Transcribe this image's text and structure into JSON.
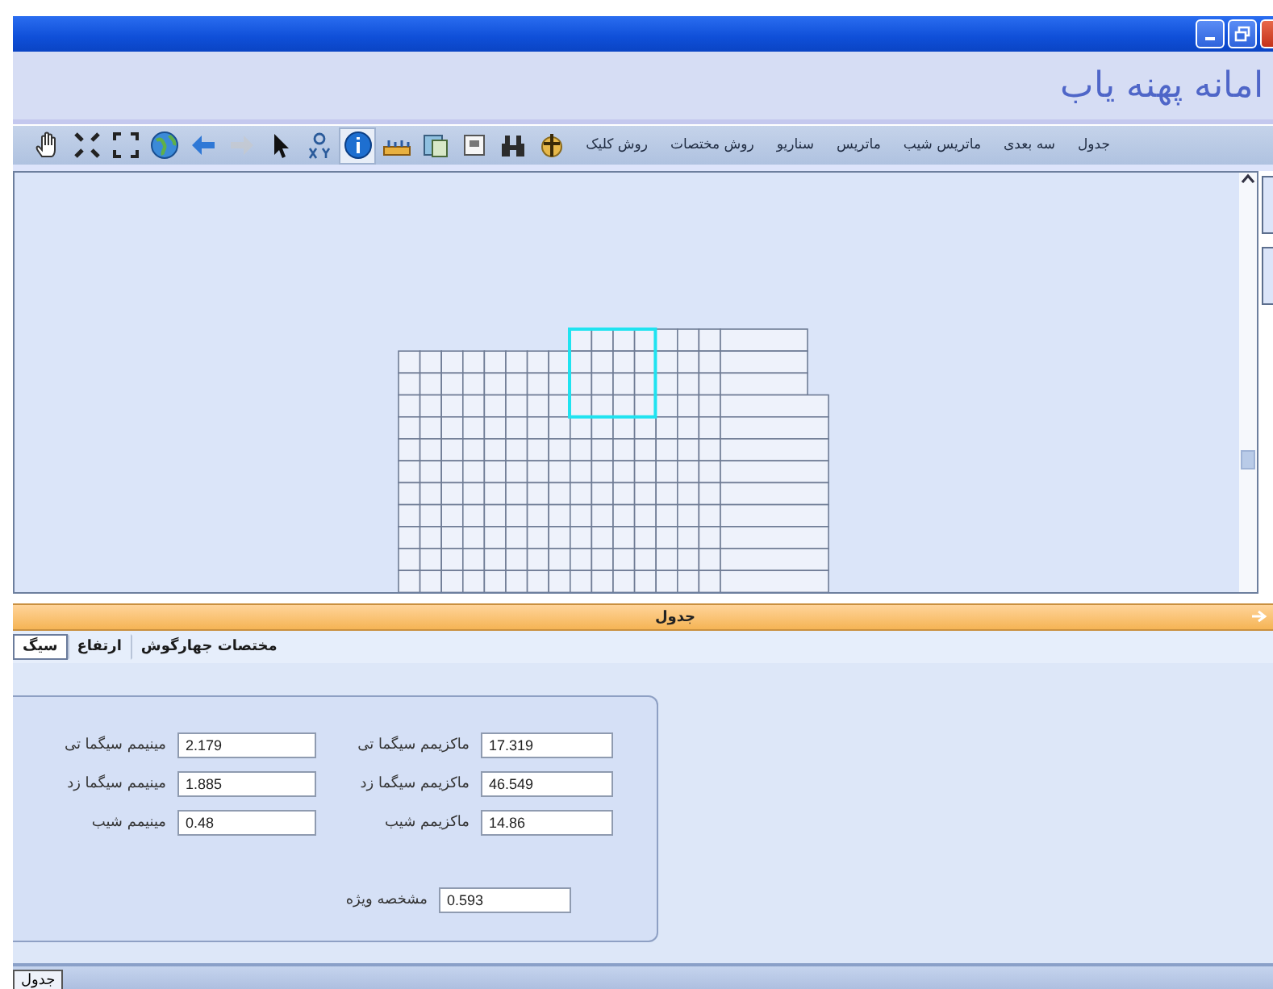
{
  "window": {
    "title_buttons": [
      {
        "kind": "minimize"
      },
      {
        "kind": "restore"
      },
      {
        "kind": "close"
      }
    ]
  },
  "header": {
    "logo": "امانه پهنه یاب"
  },
  "toolbar": {
    "menu": [
      "جدول",
      "سه بعدی",
      "ماتریس شیب",
      "ماتریس",
      "سناریو",
      "روش مختصات",
      "روش کلیک"
    ],
    "tools": [
      {
        "kind": "anchor",
        "selected": false,
        "disabled": false
      },
      {
        "kind": "binoculars",
        "selected": false,
        "disabled": false
      },
      {
        "kind": "frame",
        "selected": false,
        "disabled": false
      },
      {
        "kind": "map",
        "selected": false,
        "disabled": false
      },
      {
        "kind": "ruler",
        "selected": false,
        "disabled": false
      },
      {
        "kind": "info",
        "selected": true,
        "disabled": false
      },
      {
        "kind": "xy",
        "selected": false,
        "disabled": false
      },
      {
        "kind": "pointer",
        "selected": false,
        "disabled": false
      },
      {
        "kind": "arrow-right",
        "selected": false,
        "disabled": true
      },
      {
        "kind": "arrow-left",
        "selected": false,
        "disabled": false
      },
      {
        "kind": "globe",
        "selected": false,
        "disabled": false
      },
      {
        "kind": "expand",
        "selected": false,
        "disabled": false
      },
      {
        "kind": "shrink",
        "selected": false,
        "disabled": false
      },
      {
        "kind": "hand",
        "selected": false,
        "disabled": false
      }
    ]
  },
  "panel": {
    "title": "جدول",
    "tabs": [
      {
        "label": "مختصات جهارگوش",
        "selected": false
      },
      {
        "label": "ارتفاع",
        "selected": false
      },
      {
        "label": "سیگ",
        "selected": true
      }
    ],
    "rows": [
      [
        {
          "label": "ماکزیمم سیگما تی",
          "value": "17.319"
        },
        {
          "label": "مینیمم سیگما تی",
          "value": "2.179"
        }
      ],
      [
        {
          "label": "ماکزیمم سیگما زد",
          "value": "46.549"
        },
        {
          "label": "مینیمم سیگما زد",
          "value": "1.885"
        }
      ],
      [
        {
          "label": "ماکزیمم شیب",
          "value": "14.86"
        },
        {
          "label": "مینیمم شیب",
          "value": "0.48"
        }
      ],
      [
        {
          "label": "مشخصه ویژه",
          "value": "0.593"
        }
      ]
    ]
  },
  "status_bar": {
    "tabs": [
      {
        "label": "جدول",
        "selected": true
      }
    ]
  }
}
